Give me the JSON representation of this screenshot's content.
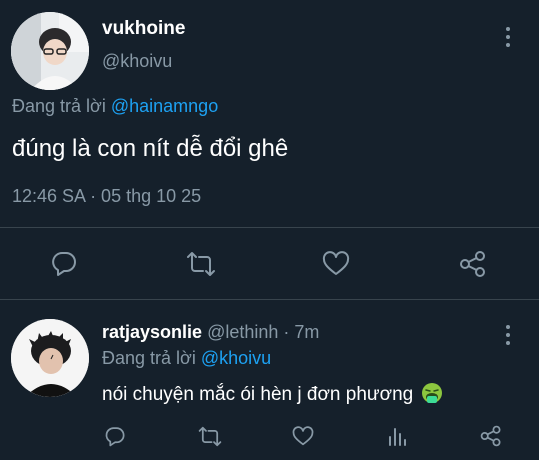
{
  "main_tweet": {
    "display_name": "vukhoine",
    "handle": "@khoivu",
    "reply_prefix": "Đang trả lời",
    "reply_to": "@hainamngo",
    "text": "đúng là con nít dễ đổi ghê",
    "timestamp": "12:46 SA · 05 thg 10 25",
    "actions": {
      "reply": "reply-icon",
      "retweet": "retweet-icon",
      "like": "heart-icon",
      "share": "share-icon"
    }
  },
  "reply_tweet": {
    "display_name": "ratjaysonlie",
    "handle": "@lethinh",
    "time_ago": "· 7m",
    "reply_prefix": "Đang trả lời",
    "reply_to": "@khoivu",
    "text": "nói chuyện mắc ói hèn j đơn phương",
    "emoji": "🤮",
    "actions": {
      "reply": "reply-icon",
      "retweet": "retweet-icon",
      "like": "heart-icon",
      "analytics": "analytics-icon",
      "share": "share-icon"
    }
  },
  "colors": {
    "background": "#15202b",
    "muted": "#8899a6",
    "link": "#1da1f2",
    "divider": "#38444d"
  }
}
